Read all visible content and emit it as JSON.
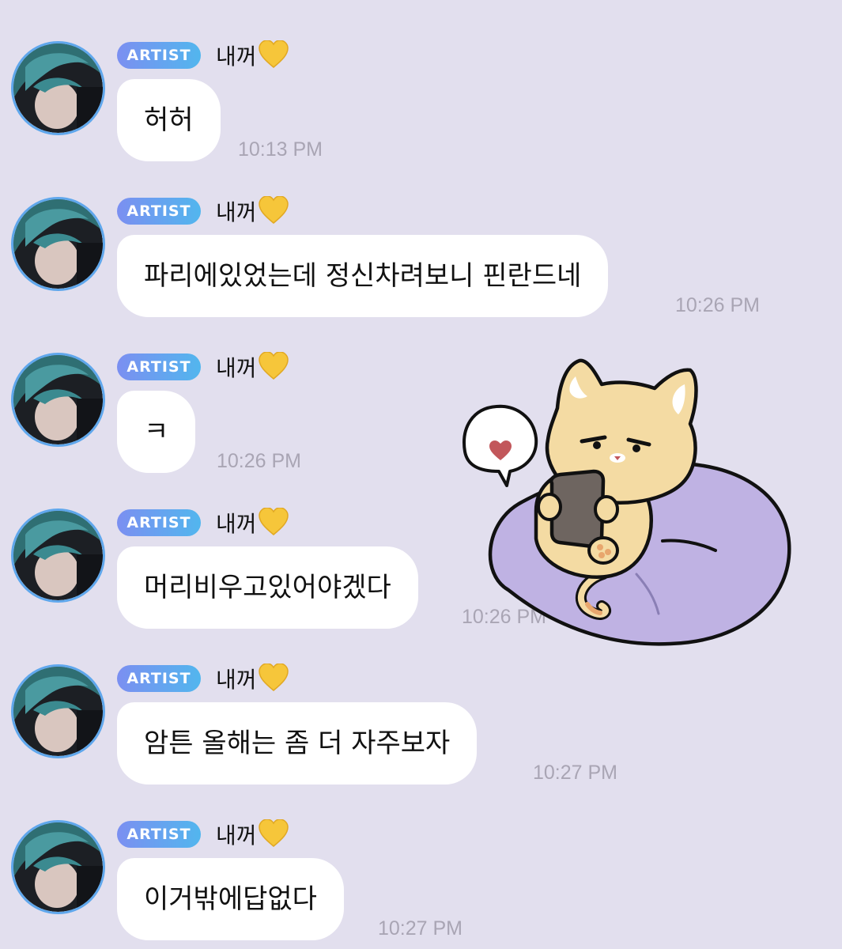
{
  "badge_label": "ARTIST",
  "sender_name": "내꺼",
  "heart_emoji": "yellow-heart",
  "colors": {
    "background": "#e2dfee",
    "bubble": "#ffffff",
    "badge_start": "#7b8ff1",
    "badge_end": "#52b6ee",
    "avatar_ring": "#5fa7ec",
    "timestamp": "#a9a5b4"
  },
  "messages": [
    {
      "text": "허허",
      "time": "10:13 PM"
    },
    {
      "text": "파리에있었는데 정신차려보니 핀란드네",
      "time": "10:26 PM"
    },
    {
      "text": "ㅋ",
      "time": "10:26 PM"
    },
    {
      "text": "머리비우고있어야겠다",
      "time": "10:26 PM"
    },
    {
      "text": "암튼 올해는 좀 더 자주보자",
      "time": "10:27 PM"
    },
    {
      "text": "이거밖에답없다",
      "time": "10:27 PM"
    }
  ],
  "sticker": {
    "icon": "cat-on-beanbag-with-phone-sticker"
  }
}
